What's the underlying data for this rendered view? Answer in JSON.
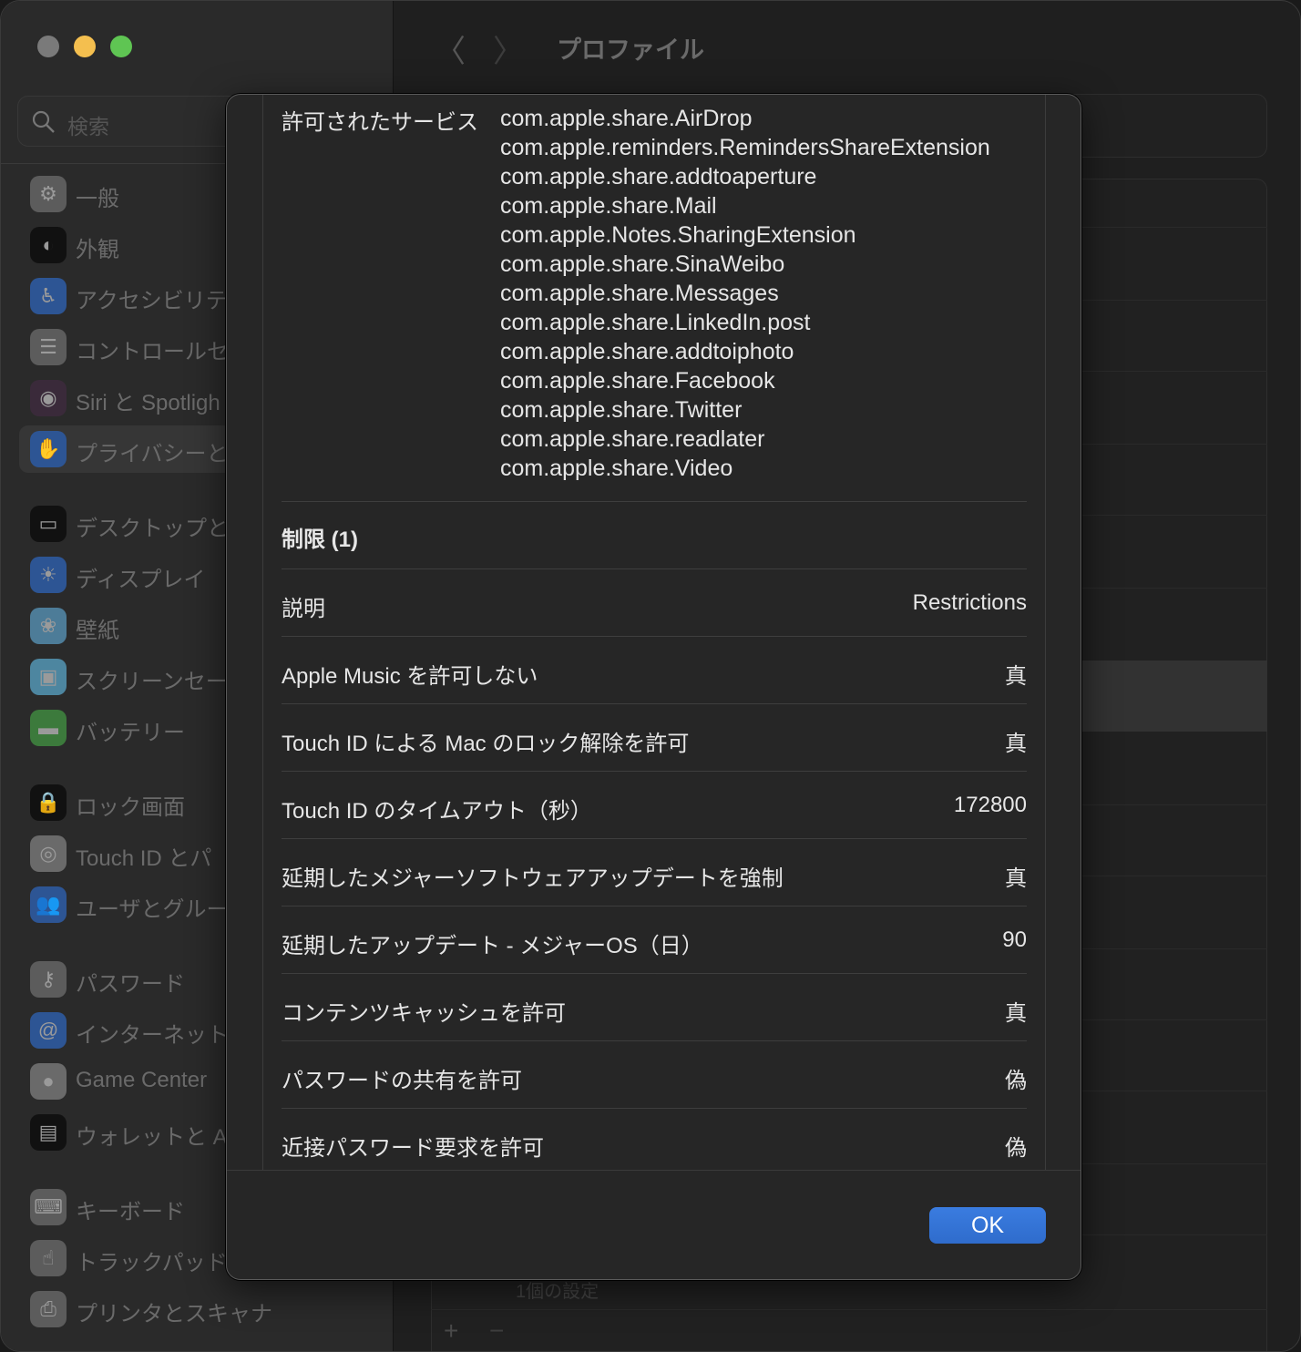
{
  "window": {
    "title": "プロファイル",
    "traffic_colors": {
      "close": "#7a7a7a",
      "minimize": "#f4bf4f",
      "zoom": "#5fc553"
    }
  },
  "search": {
    "placeholder": "検索"
  },
  "sidebar": {
    "items": [
      {
        "label": "一般",
        "icon": "gear-icon",
        "color": "#5c5c5c",
        "glyph": "⚙"
      },
      {
        "label": "外観",
        "icon": "appearance-icon",
        "color": "#111111",
        "glyph": "◐"
      },
      {
        "label": "アクセシビリテ",
        "icon": "accessibility-icon",
        "color": "#2d5594",
        "glyph": "♿"
      },
      {
        "label": "コントロールセ",
        "icon": "control-center-icon",
        "color": "#5c5c5c",
        "glyph": "☰"
      },
      {
        "label": "Siri と Spotligh",
        "icon": "siri-icon",
        "color": "#3a2a3a",
        "glyph": "◉"
      },
      {
        "label": "プライバシーと",
        "icon": "hand-icon",
        "color": "#2d5594",
        "glyph": "✋"
      },
      {
        "label": "デスクトップと",
        "icon": "desktop-icon",
        "color": "#111111",
        "glyph": "▭"
      },
      {
        "label": "ディスプレイ",
        "icon": "sun-icon",
        "color": "#2d5594",
        "glyph": "☀"
      },
      {
        "label": "壁紙",
        "icon": "flower-icon",
        "color": "#4d7c98",
        "glyph": "❀"
      },
      {
        "label": "スクリーンセー",
        "icon": "screensaver-icon",
        "color": "#4d86a0",
        "glyph": "▣"
      },
      {
        "label": "バッテリー",
        "icon": "battery-icon",
        "color": "#3c7a3c",
        "glyph": "▬"
      },
      {
        "label": "ロック画面",
        "icon": "lock-icon",
        "color": "#111111",
        "glyph": "🔒"
      },
      {
        "label": "Touch ID とパ",
        "icon": "fingerprint-icon",
        "color": "#6a6a6a",
        "glyph": "◎"
      },
      {
        "label": "ユーザとグルー",
        "icon": "users-icon",
        "color": "#2d5594",
        "glyph": "👥"
      },
      {
        "label": "パスワード",
        "icon": "key-icon",
        "color": "#5c5c5c",
        "glyph": "⚷"
      },
      {
        "label": "インターネット",
        "icon": "at-icon",
        "color": "#2d5594",
        "glyph": "@"
      },
      {
        "label": "Game Center",
        "icon": "game-center-icon",
        "color": "#6a6a6a",
        "glyph": "●"
      },
      {
        "label": "ウォレットと A",
        "icon": "wallet-icon",
        "color": "#111111",
        "glyph": "▤"
      },
      {
        "label": "キーボード",
        "icon": "keyboard-icon",
        "color": "#5c5c5c",
        "glyph": "⌨"
      },
      {
        "label": "トラックパッド",
        "icon": "trackpad-icon",
        "color": "#5c5c5c",
        "glyph": "☝"
      },
      {
        "label": "プリンタとスキャナ",
        "icon": "printer-icon",
        "color": "#5c5c5c",
        "glyph": "⎙"
      }
    ],
    "selected": 5
  },
  "background": {
    "footer_text": "1個の設定",
    "add": "+",
    "remove": "−"
  },
  "sheet": {
    "services_label": "許可されたサービス",
    "services": [
      "com.apple.share.AirDrop",
      "com.apple.reminders.RemindersShareExtension",
      "com.apple.share.addtoaperture",
      "com.apple.share.Mail",
      "com.apple.Notes.SharingExtension",
      "com.apple.share.SinaWeibo",
      "com.apple.share.Messages",
      "com.apple.share.LinkedIn.post",
      "com.apple.share.addtoiphoto",
      "com.apple.share.Facebook",
      "com.apple.share.Twitter",
      "com.apple.share.readlater",
      "com.apple.share.Video"
    ],
    "restrictions_heading": "制限 (1)",
    "rows": [
      {
        "key": "説明",
        "value": "Restrictions"
      },
      {
        "key": "Apple Music を許可しない",
        "value": "真"
      },
      {
        "key": "Touch ID による Mac のロック解除を許可",
        "value": "真"
      },
      {
        "key": "Touch ID のタイムアウト（秒）",
        "value": "172800"
      },
      {
        "key": "延期したメジャーソフトウェアアップデートを強制",
        "value": "真"
      },
      {
        "key": "延期したアップデート - メジャーOS（日）",
        "value": "90"
      },
      {
        "key": "コンテンツキャッシュを許可",
        "value": "真"
      },
      {
        "key": "パスワードの共有を許可",
        "value": "偽"
      },
      {
        "key": "近接パスワード要求を許可",
        "value": "偽"
      }
    ],
    "ok_label": "OK",
    "ok_color": "#3478dc"
  }
}
